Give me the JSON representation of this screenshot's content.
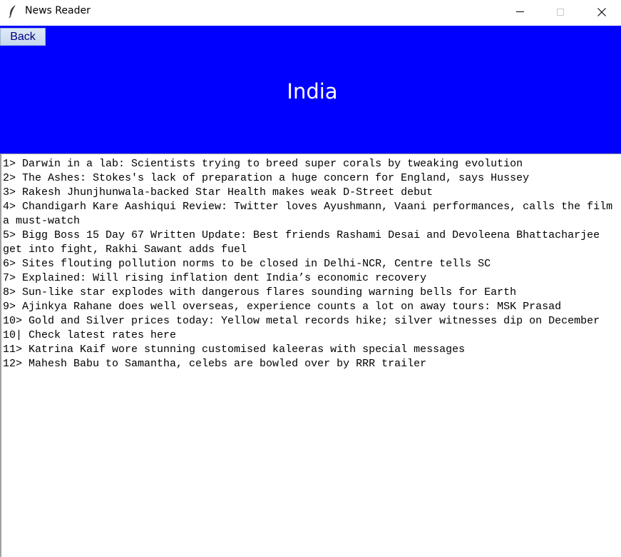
{
  "window": {
    "title": "News Reader",
    "controls": {
      "minimize": "minimize-icon",
      "maximize": "maximize-icon",
      "close": "close-icon"
    }
  },
  "header": {
    "back_label": "Back",
    "title": "India",
    "background_color": "#0000ff",
    "title_color": "#ffffff"
  },
  "news": {
    "items": [
      "1> Darwin in a lab: Scientists trying to breed super corals by tweaking evolution",
      "2> The Ashes: Stokes's lack of preparation a huge concern for England, says Hussey",
      "3> Rakesh Jhunjhunwala-backed Star Health makes weak D-Street debut",
      "4> Chandigarh Kare Aashiqui Review: Twitter loves Ayushmann, Vaani performances, calls the film a must-watch",
      "5> Bigg Boss 15 Day 67 Written Update: Best friends Rashami Desai and Devoleena Bhattacharjee get into fight, Rakhi Sawant adds fuel",
      "6> Sites flouting pollution norms to be closed in Delhi-NCR, Centre tells SC",
      "7> Explained: Will rising inflation dent India’s economic recovery",
      "8> Sun-like star explodes with dangerous flares sounding warning bells for Earth",
      "9> Ajinkya Rahane does well overseas, experience counts a lot on away tours: MSK Prasad",
      "10> Gold and Silver prices today: Yellow metal records hike; silver witnesses dip on December 10| Check latest rates here",
      "11> Katrina Kaif wore stunning customised kaleeras with special messages",
      "12> Mahesh Babu to Samantha, celebs are bowled over by RRR trailer"
    ]
  }
}
